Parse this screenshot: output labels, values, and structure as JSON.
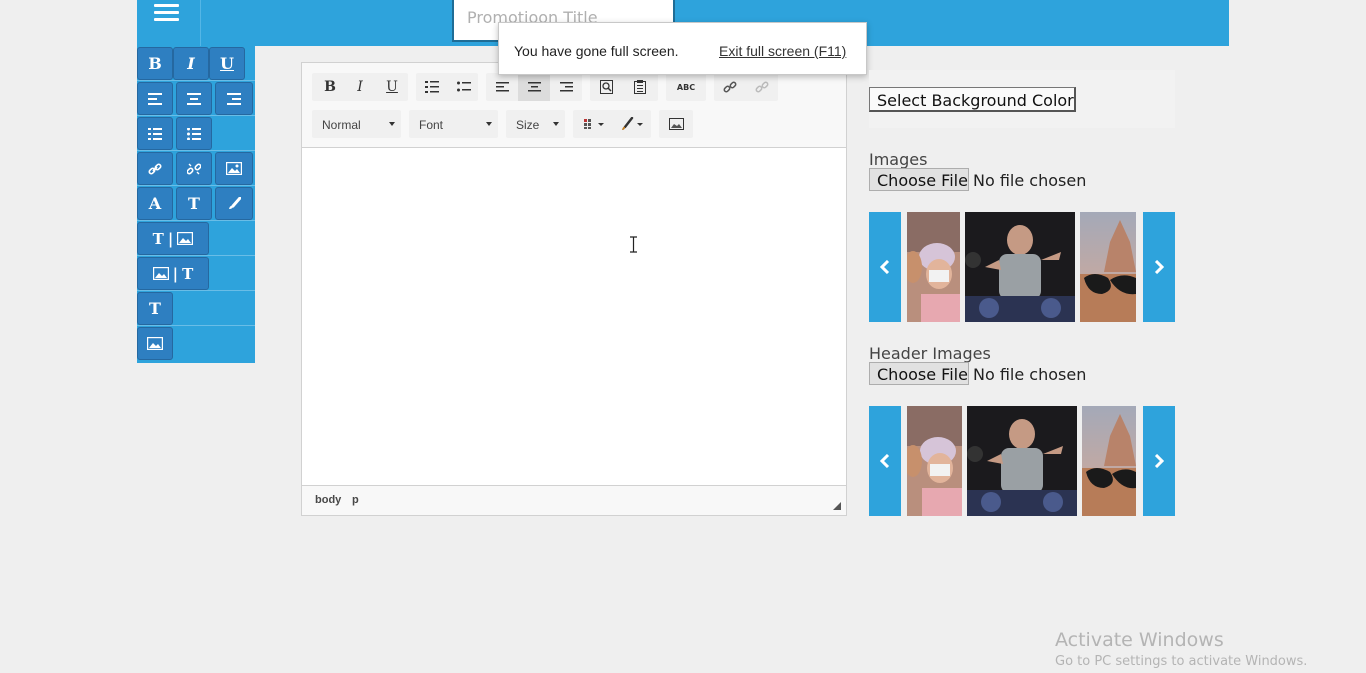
{
  "header": {
    "menu_icon": "hamburger-icon",
    "title_input_placeholder": "Promotioon Title"
  },
  "side_palette": {
    "rows": [
      [
        {
          "label": "B",
          "icon": "bold-icon"
        },
        {
          "label": "I",
          "icon": "italic-icon"
        },
        {
          "label": "U",
          "icon": "underline-icon"
        }
      ],
      [
        {
          "icon": "align-left-icon"
        },
        {
          "icon": "align-center-icon"
        },
        {
          "icon": "align-right-icon"
        }
      ],
      [
        {
          "icon": "ordered-list-icon"
        },
        {
          "icon": "unordered-list-icon"
        }
      ],
      [
        {
          "icon": "link-icon"
        },
        {
          "icon": "unlink-icon"
        },
        {
          "icon": "image-icon"
        }
      ],
      [
        {
          "label": "A",
          "icon": "font-color-icon"
        },
        {
          "label": "T",
          "icon": "text-size-icon"
        },
        {
          "icon": "paint-brush-icon"
        }
      ],
      [
        {
          "icon": "text-then-image-icon",
          "separator": "|"
        }
      ],
      [
        {
          "icon": "image-then-text-icon",
          "separator": "|"
        }
      ],
      [
        {
          "icon": "text-block-icon"
        }
      ],
      [
        {
          "icon": "image-block-icon"
        }
      ]
    ]
  },
  "editor": {
    "toolbar": {
      "format_combo": "Normal",
      "font_combo": "Font",
      "size_combo": "Size",
      "buttons": [
        "bold-icon",
        "italic-icon",
        "underline-icon",
        "numbered-list-icon",
        "bulleted-list-icon",
        "align-left-icon",
        "align-center-icon",
        "align-right-icon",
        "find-icon",
        "paste-icon",
        "spellcheck-icon",
        "link-icon",
        "unlink-icon",
        "table-icon",
        "text-color-icon",
        "image-icon"
      ]
    },
    "bold_label": "B",
    "italic_label": "I",
    "underline_label": "U",
    "spell_label": "ABC",
    "elements_path": [
      "body",
      "p"
    ]
  },
  "fullscreen_notice": {
    "message": "You have gone full screen.",
    "exit_label": "Exit full screen (F11)"
  },
  "right_panel": {
    "bg_color_button": "Select Background Color",
    "images_label": "Images",
    "header_images_label": "Header Images",
    "choose_file_label": "Choose File",
    "no_file_text": "No file chosen",
    "prev_icon": "chevron-left-icon",
    "next_icon": "chevron-right-icon"
  },
  "watermark": {
    "title": "Activate Windows",
    "subtitle": "Go to PC settings to activate Windows."
  }
}
